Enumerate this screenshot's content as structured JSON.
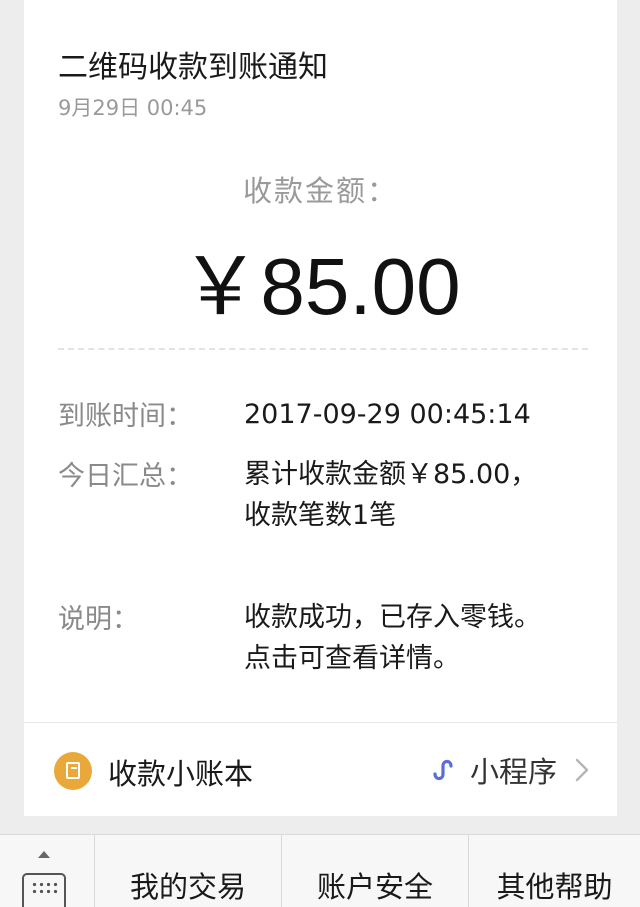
{
  "notification": {
    "title": "二维码收款到账通知",
    "date": "9月29日 00:45",
    "amount_label": "收款金额：",
    "amount": "￥85.00",
    "rows": [
      {
        "label": "到账时间：",
        "value": "2017-09-29 00:45:14"
      },
      {
        "label": "今日汇总：",
        "value": "累计收款金额￥85.00，收款笔数1笔"
      },
      {
        "label": "说明：",
        "value": "收款成功，已存入零钱。点击可查看详情。"
      }
    ]
  },
  "footer": {
    "ledger_label": "收款小账本",
    "ledger_icon": "ledger-book-icon",
    "ledger_icon_color": "#e8a93a",
    "mini_program_label": "小程序",
    "mini_program_icon": "link-icon",
    "mini_program_icon_color": "#5a6fd6"
  },
  "tabbar": {
    "keyboard_icon": "keyboard-icon",
    "tabs": [
      {
        "label": "我的交易"
      },
      {
        "label": "账户安全"
      },
      {
        "label": "其他帮助"
      }
    ]
  }
}
